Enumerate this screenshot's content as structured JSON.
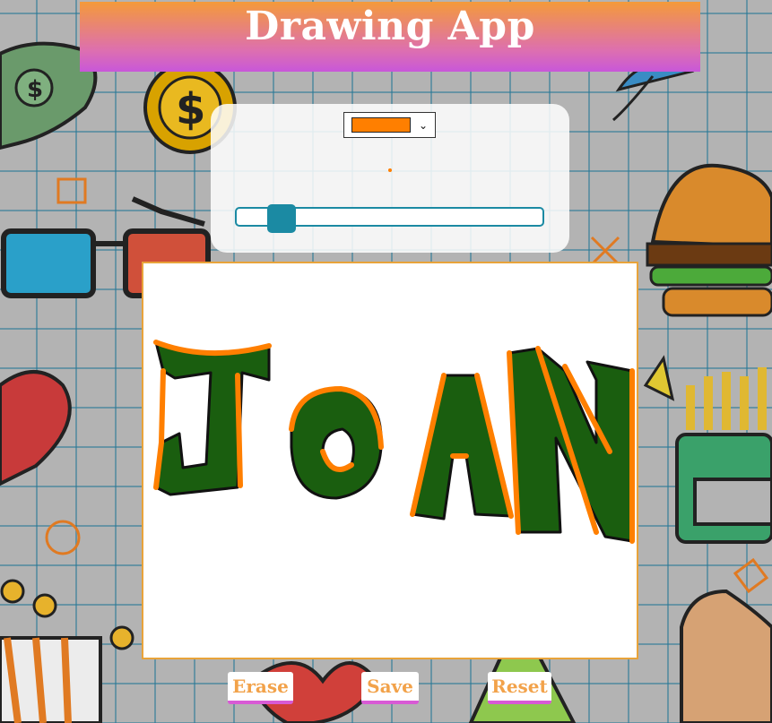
{
  "header": {
    "title": "Drawing App"
  },
  "controls": {
    "color_select": {
      "selected_color": "#ff7f00"
    },
    "brush_size": {
      "value": 5,
      "min": 1,
      "max": 50
    }
  },
  "canvas": {
    "drawing_text": "JOAN",
    "fill_color": "#1a5e0f",
    "stroke_color": "#ff7f00"
  },
  "buttons": {
    "erase": "Erase",
    "save": "Save",
    "reset": "Reset"
  },
  "background": {
    "icons": [
      "dollar-bill-icon",
      "coin-icon",
      "umbrella-icon",
      "sunglasses-icon",
      "burger-icon",
      "heart-icon",
      "fries-icon",
      "popcorn-icon",
      "thumbs-up-icon",
      "lollipop-icon"
    ]
  }
}
